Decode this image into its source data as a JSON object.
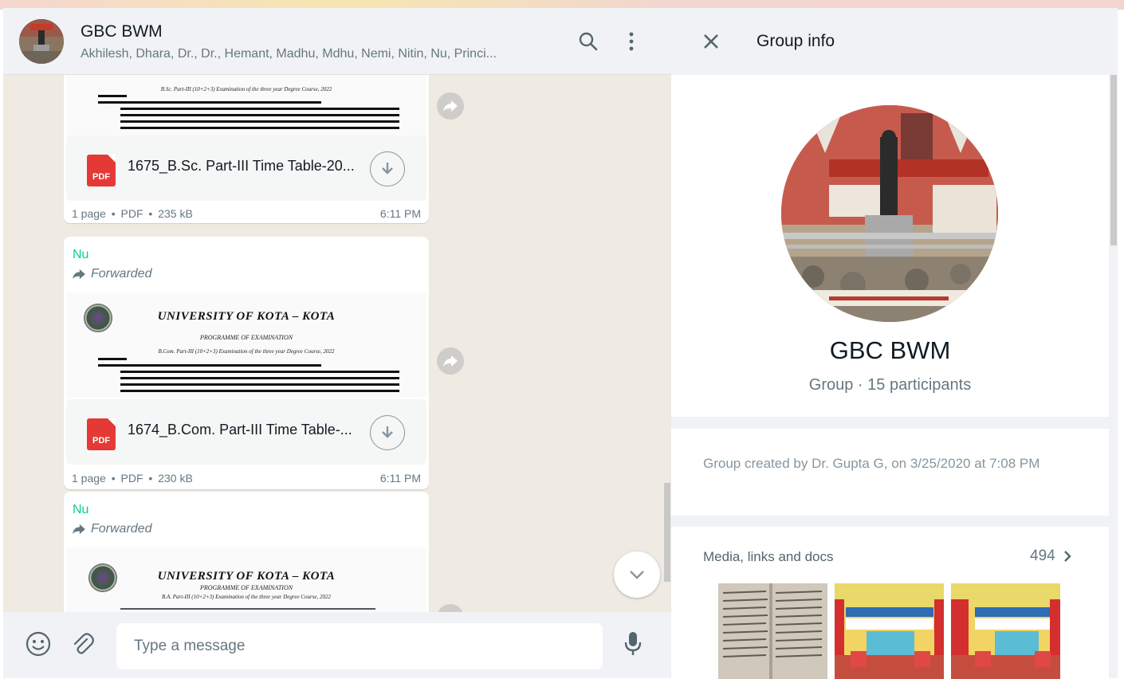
{
  "chat": {
    "title": "GBC BWM",
    "participants": "Akhilesh, Dhara, Dr., Dr., Hemant, Madhu, Mdhu, Nemi, Nitin, Nu, Princi...",
    "messages": [
      {
        "doc_name": "1675_B.Sc. Part-III Time Table-20...",
        "pages": "1 page",
        "type": "PDF",
        "size": "235 kB",
        "time": "6:11 PM",
        "preview_line": "B.Sc. Part-III (10+2+3) Examination of the three year Degree Course, 2022"
      },
      {
        "sender": "Nu",
        "forwarded": "Forwarded",
        "university": "UNIVERSITY OF KOTA – KOTA",
        "programme": "PROGRAMME OF EXAMINATION",
        "preview_line": "B.Com. Part-III (10+2+3) Examination of the three year Degree Course, 2022",
        "doc_name": "1674_B.Com. Part-III Time Table-...",
        "pages": "1 page",
        "type": "PDF",
        "size": "230 kB",
        "time": "6:11 PM"
      },
      {
        "sender": "Nu",
        "forwarded": "Forwarded",
        "university": "UNIVERSITY OF KOTA – KOTA",
        "programme": "PROGRAMME OF EXAMINATION",
        "preview_line": "B.A. Part-III (10+2+3) Examination of the three year Degree Course, 2022"
      }
    ],
    "pdf_label": "PDF",
    "separator": "•",
    "input_placeholder": "Type a message"
  },
  "info": {
    "title": "Group info",
    "group_name": "GBC BWM",
    "group_meta": "Group · 15 participants",
    "created": "Group created by Dr. Gupta G, on 3/25/2020 at 7:08 PM",
    "media_label": "Media, links and docs",
    "media_count": "494"
  },
  "colors": {
    "sender": "#06cf9c",
    "pdf": "#e53935",
    "chat_bg": "#efeae2",
    "panel_bg": "#f0f2f5"
  }
}
